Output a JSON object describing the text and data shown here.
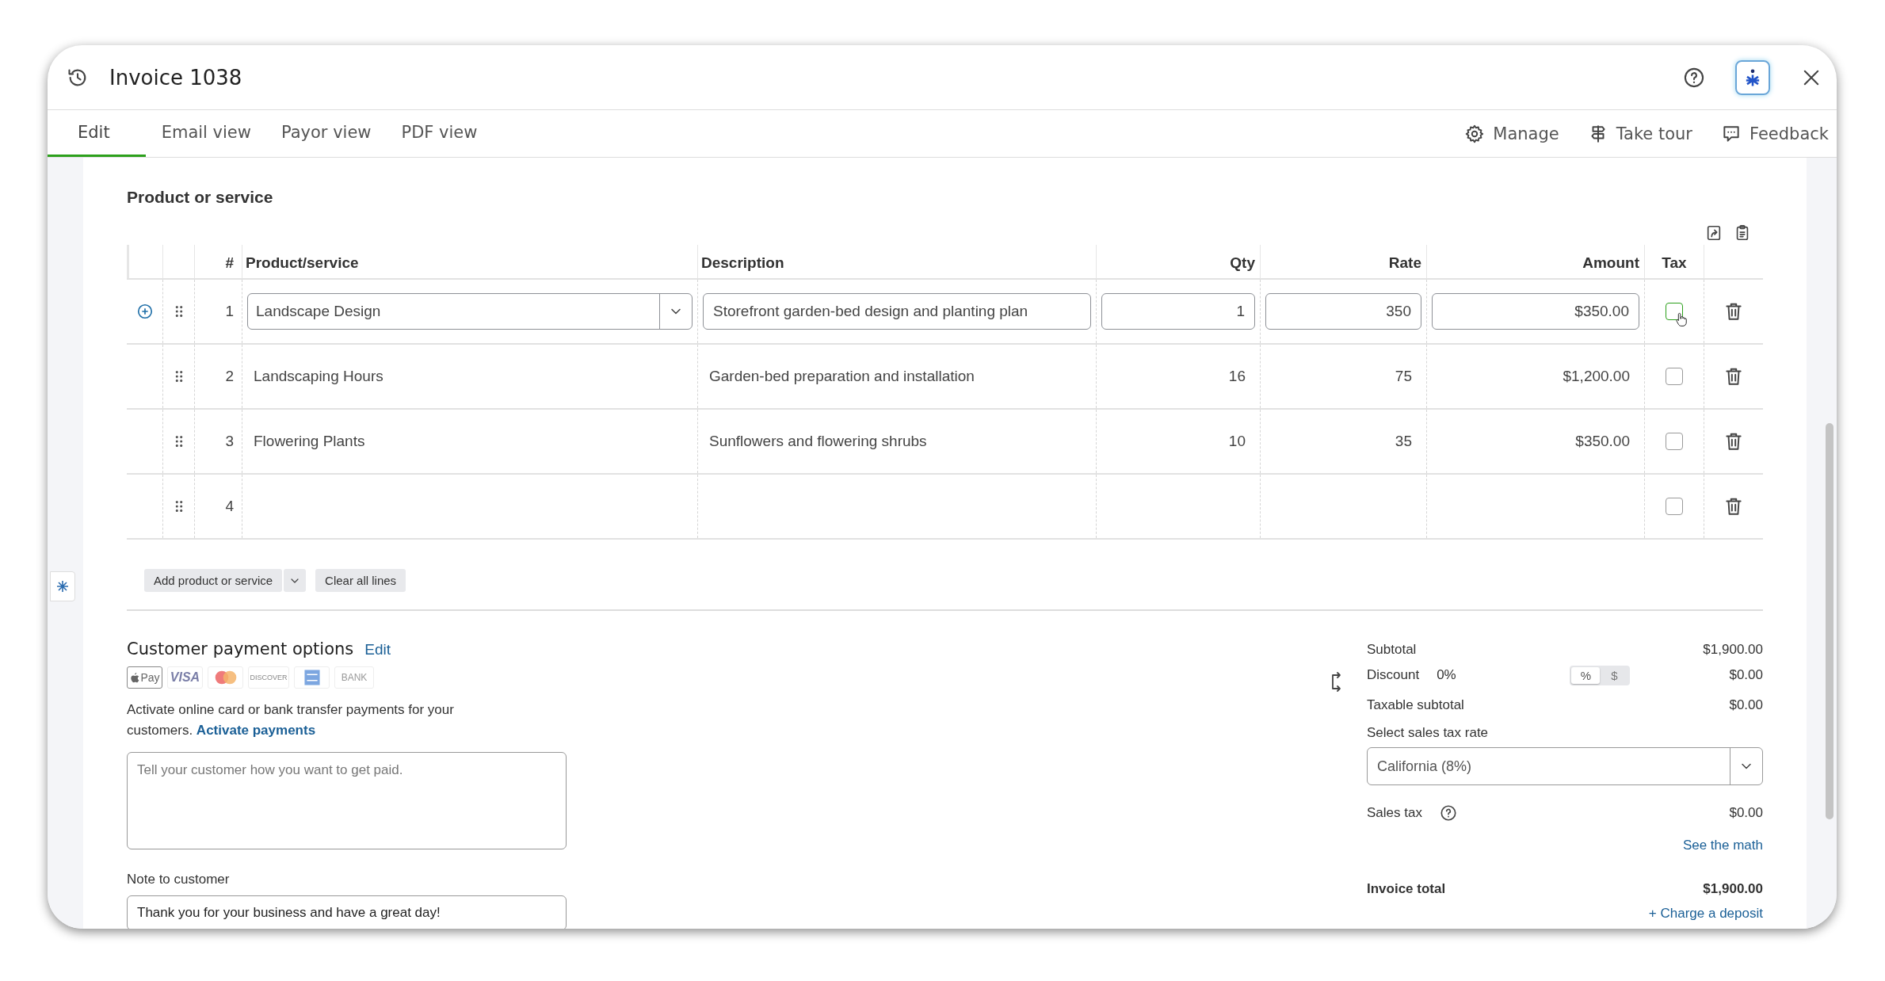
{
  "window": {
    "title": "Invoice 1038"
  },
  "tabs": [
    {
      "label": "Edit",
      "selected": true
    },
    {
      "label": "Email view",
      "selected": false
    },
    {
      "label": "Payor view",
      "selected": false
    },
    {
      "label": "PDF view",
      "selected": false
    }
  ],
  "toolbar_actions": [
    {
      "label": "Manage"
    },
    {
      "label": "Take tour"
    },
    {
      "label": "Feedback"
    }
  ],
  "product_section": {
    "title": "Product or service",
    "columns": [
      "#",
      "Product/service",
      "Description",
      "Qty",
      "Rate",
      "Amount",
      "Tax"
    ],
    "rows": [
      {
        "number": "1",
        "product": "Landscape Design",
        "description": "Storefront garden-bed design and planting plan",
        "qty": "1",
        "rate": "350",
        "amount": "$350.00",
        "taxable": false,
        "tax_hovered": true,
        "editing": true
      },
      {
        "number": "2",
        "product": "Landscaping Hours",
        "description": "Garden-bed preparation and installation",
        "qty": "16",
        "rate": "75",
        "amount": "$1,200.00",
        "taxable": false,
        "tax_hovered": false,
        "editing": false
      },
      {
        "number": "3",
        "product": "Flowering Plants",
        "description": "Sunflowers and flowering shrubs",
        "qty": "10",
        "rate": "35",
        "amount": "$350.00",
        "taxable": false,
        "tax_hovered": false,
        "editing": false
      },
      {
        "number": "4",
        "taxable": false,
        "tax_hovered": false,
        "editing": false
      }
    ],
    "add_button": "Add product or service",
    "clear_button": "Clear all lines"
  },
  "payment_options": {
    "title": "Customer payment options",
    "edit_link": "Edit",
    "methods": [
      {
        "kind": "applepay",
        "label": "Pay"
      },
      {
        "kind": "visa",
        "label": "VISA"
      },
      {
        "kind": "mastercard"
      },
      {
        "kind": "discover",
        "label": "DISCOVER"
      },
      {
        "kind": "amex"
      },
      {
        "kind": "bank",
        "label": "BANK"
      }
    ],
    "message": "Activate online card or bank transfer payments for your customers.",
    "activate_link": "Activate payments",
    "instructions_placeholder": "Tell your customer how you want to get paid.",
    "note_label": "Note to customer",
    "note_value": "Thank you for your business and have a great day!"
  },
  "totals": {
    "subtotal_label": "Subtotal",
    "subtotal": "$1,900.00",
    "discount_label": "Discount",
    "discount_percent": "0%",
    "discount_modes": [
      {
        "label": "%",
        "selected": true
      },
      {
        "label": "$",
        "selected": false
      }
    ],
    "discount": "$0.00",
    "taxable_label": "Taxable subtotal",
    "taxable_subtotal": "$0.00",
    "tax_rate_label": "Select sales tax rate",
    "tax_rate": "California (8%)",
    "sales_tax_label": "Sales tax",
    "sales_tax": "$0.00",
    "see_math_link": "See the math",
    "total_label": "Invoice total",
    "total": "$1,900.00",
    "deposit_link": "+ Charge a deposit"
  }
}
